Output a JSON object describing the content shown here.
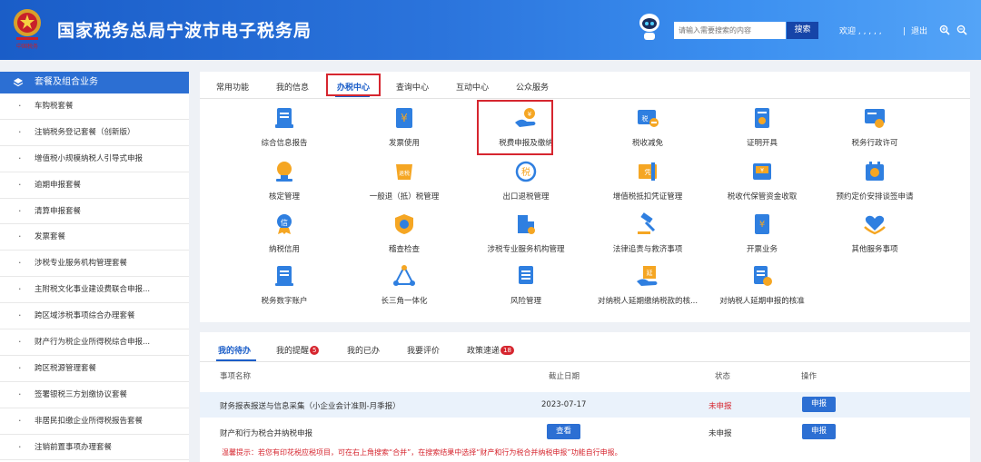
{
  "header": {
    "title": "国家税务总局宁波市电子税务局",
    "search_placeholder": "请输入需要搜索的内容",
    "search_button": "搜索",
    "welcome": "欢迎 , , , , ,",
    "logout": "退出"
  },
  "sidebar": {
    "heading": "套餐及组合业务",
    "items": [
      {
        "label": "车购税套餐"
      },
      {
        "label": "注销税务登记套餐（创新版）"
      },
      {
        "label": "增值税小规模纳税人引导式申报"
      },
      {
        "label": "逾期申报套餐"
      },
      {
        "label": "清算申报套餐"
      },
      {
        "label": "发票套餐"
      },
      {
        "label": "涉税专业服务机构管理套餐"
      },
      {
        "label": "主附税文化事业建设费联合申报..."
      },
      {
        "label": "跨区域涉税事项综合办理套餐"
      },
      {
        "label": "财产行为税企业所得税综合申报..."
      },
      {
        "label": "跨区税源管理套餐"
      },
      {
        "label": "签署银税三方划缴协议套餐"
      },
      {
        "label": "非居民扣缴企业所得税报告套餐"
      },
      {
        "label": "注销前置事项办理套餐"
      }
    ]
  },
  "main": {
    "tabs": [
      {
        "label": "常用功能"
      },
      {
        "label": "我的信息"
      },
      {
        "label": "办税中心"
      },
      {
        "label": "查询中心"
      },
      {
        "label": "互动中心"
      },
      {
        "label": "公众服务"
      }
    ],
    "grid": [
      {
        "label": "综合信息报告",
        "icon": "document-icon"
      },
      {
        "label": "发票使用",
        "icon": "invoice-icon"
      },
      {
        "label": "税费申报及缴纳",
        "icon": "hand-coin-icon"
      },
      {
        "label": "税收减免",
        "icon": "tax-reduction-icon"
      },
      {
        "label": "证明开具",
        "icon": "certificate-icon"
      },
      {
        "label": "税务行政许可",
        "icon": "license-icon"
      },
      {
        "label": "核定管理",
        "icon": "stamp-icon"
      },
      {
        "label": "一般退（抵）税管理",
        "icon": "refund-icon"
      },
      {
        "label": "出口退税管理",
        "icon": "export-refund-icon"
      },
      {
        "label": "增值税抵扣凭证管理",
        "icon": "voucher-icon"
      },
      {
        "label": "税收代保管资金收取",
        "icon": "fund-icon"
      },
      {
        "label": "预约定价安排谈签申请",
        "icon": "pricing-icon"
      },
      {
        "label": "纳税信用",
        "icon": "credit-icon"
      },
      {
        "label": "稽查检查",
        "icon": "inspection-icon"
      },
      {
        "label": "涉税专业服务机构管理",
        "icon": "building-icon"
      },
      {
        "label": "法律追责与救济事项",
        "icon": "gavel-icon"
      },
      {
        "label": "开票业务",
        "icon": "billing-icon"
      },
      {
        "label": "其他服务事项",
        "icon": "heart-hand-icon"
      },
      {
        "label": "税务数字账户",
        "icon": "digital-account-icon"
      },
      {
        "label": "长三角一体化",
        "icon": "triangle-icon"
      },
      {
        "label": "风险管理",
        "icon": "risk-icon"
      },
      {
        "label": "对纳税人延期缴纳税款的核...",
        "icon": "deferral-payment-icon"
      },
      {
        "label": "对纳税人延期申报的核准",
        "icon": "deferral-filing-icon"
      }
    ]
  },
  "tasks": {
    "tabs": [
      {
        "label": "我的待办",
        "badge": ""
      },
      {
        "label": "我的提醒",
        "badge": "5"
      },
      {
        "label": "我的已办",
        "badge": ""
      },
      {
        "label": "我要评价",
        "badge": ""
      },
      {
        "label": "政策速递",
        "badge": "18"
      }
    ],
    "columns": [
      "事项名称",
      "截止日期",
      "状态",
      "操作"
    ],
    "rows": [
      {
        "name": "财务报表报送与信息采集（小企业会计准则-月季报）",
        "date": "2023-07-17",
        "status": "未申报",
        "action": "申报"
      },
      {
        "name": "财产和行为税合并纳税申报",
        "date": "查看",
        "status": "未申报",
        "action": "申报"
      }
    ],
    "tip": "温馨提示：若您有印花税应税项目，可在右上角搜索“合并”，在搜索结果中选择“财产和行为税合并纳税申报”功能自行申报。"
  },
  "colors": {
    "brand": "#1a5dc8",
    "accent": "#2c6fd3",
    "alert": "#d6262f",
    "icon_blue": "#2f7fe0",
    "icon_orange": "#f5a623"
  }
}
